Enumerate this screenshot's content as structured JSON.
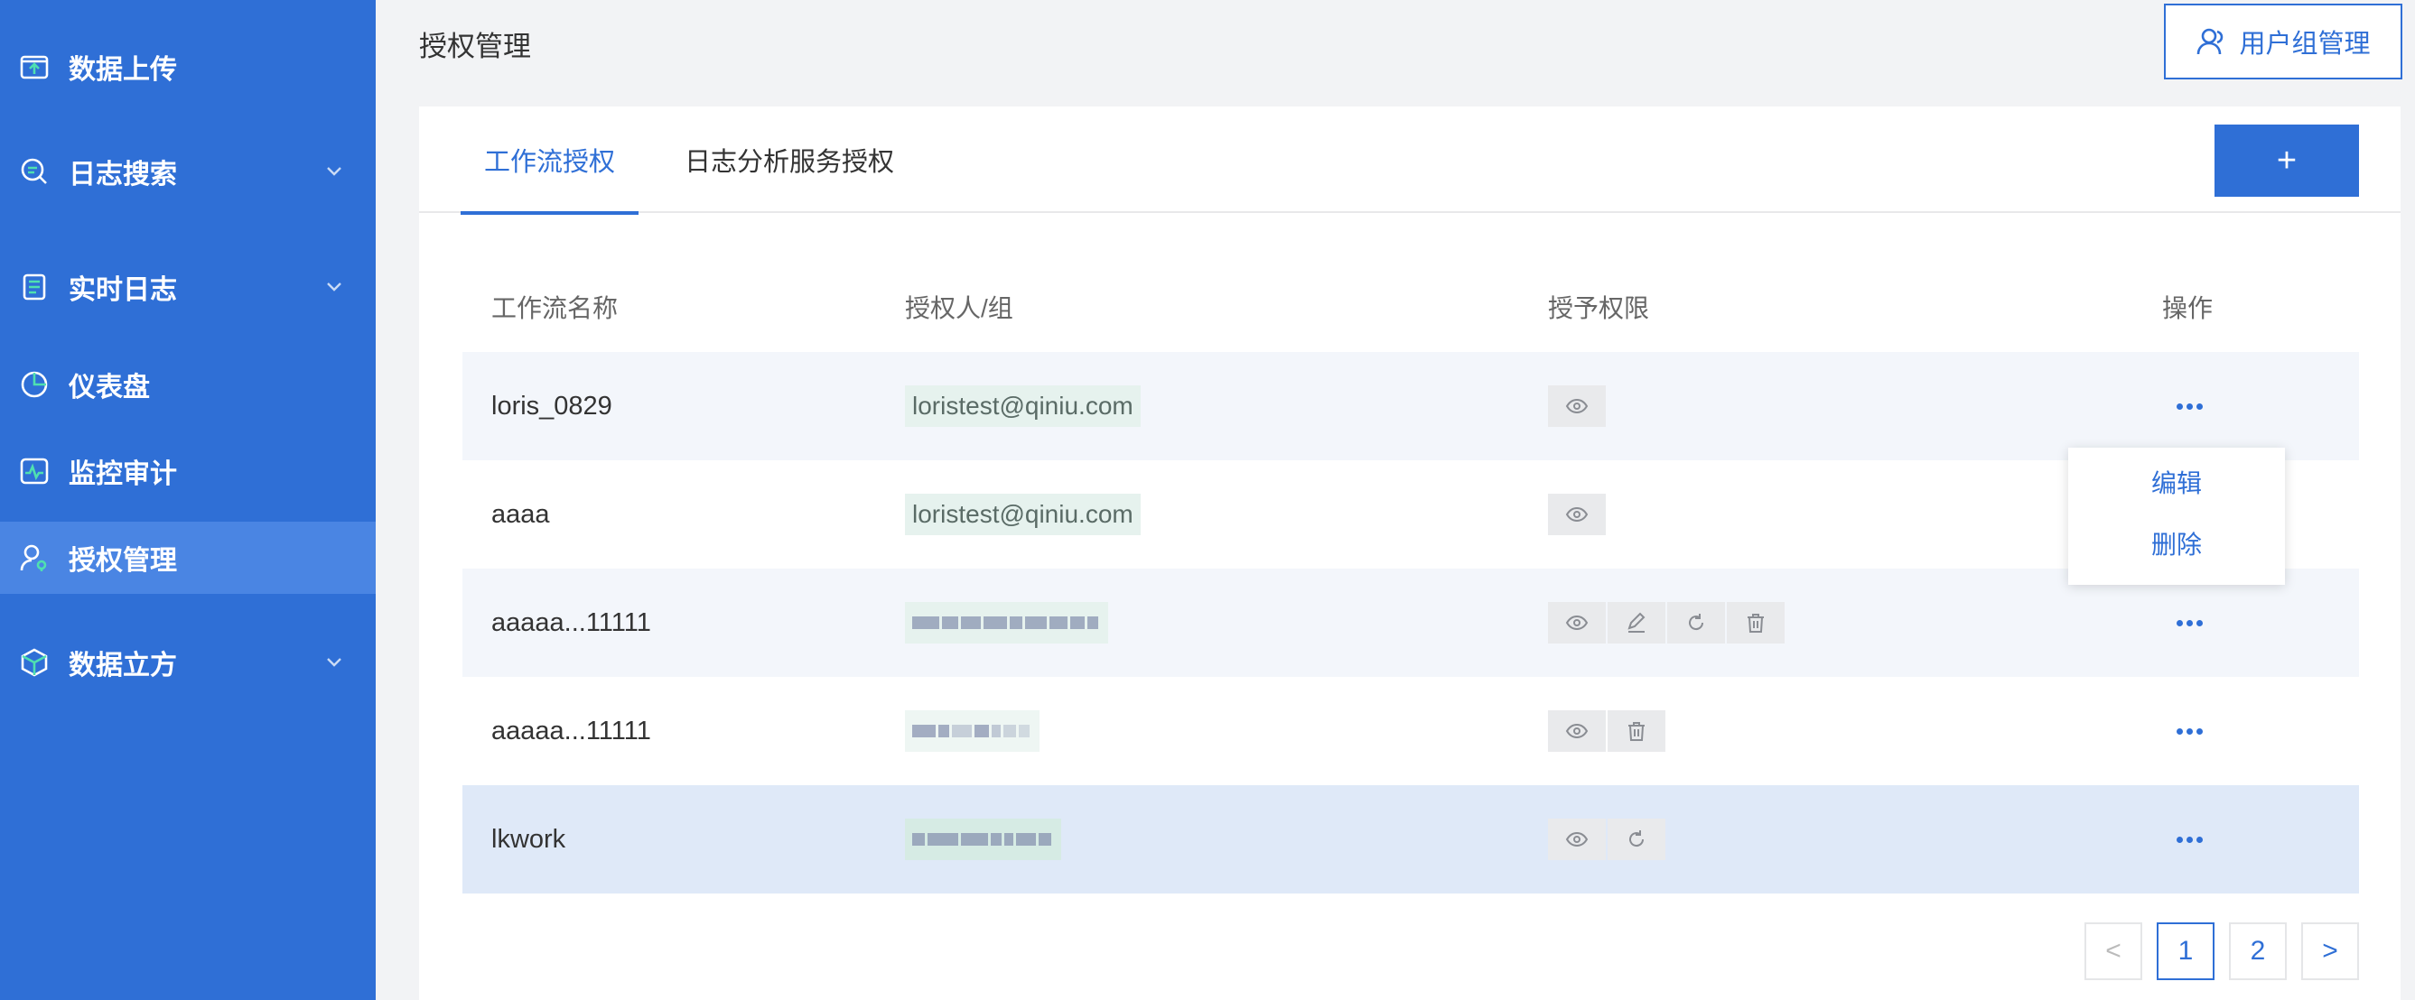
{
  "sidebar": {
    "items": [
      {
        "label": "数据上传",
        "icon": "upload-folder-icon",
        "has_children": false,
        "active": false
      },
      {
        "label": "日志搜索",
        "icon": "search-log-icon",
        "has_children": true,
        "active": false
      },
      {
        "label": "实时日志",
        "icon": "realtime-log-icon",
        "has_children": true,
        "active": false
      },
      {
        "label": "仪表盘",
        "icon": "dashboard-icon",
        "has_children": false,
        "active": false
      },
      {
        "label": "监控审计",
        "icon": "monitor-icon",
        "has_children": false,
        "active": false
      },
      {
        "label": "授权管理",
        "icon": "user-key-icon",
        "has_children": false,
        "active": true
      },
      {
        "label": "数据立方",
        "icon": "cube-icon",
        "has_children": true,
        "active": false
      }
    ]
  },
  "header": {
    "title": "授权管理",
    "group_button_label": "用户组管理"
  },
  "tabs": [
    {
      "label": "工作流授权",
      "active": true
    },
    {
      "label": "日志分析服务授权",
      "active": false
    }
  ],
  "add_button_label": "+",
  "table": {
    "columns": [
      "工作流名称",
      "授权人/组",
      "授予权限",
      "操作"
    ],
    "rows": [
      {
        "name": "loris_0829",
        "user": "loristest@qiniu.com",
        "user_redacted": false,
        "perms": [
          "view-icon"
        ]
      },
      {
        "name": "aaaa",
        "user": "loristest@qiniu.com",
        "user_redacted": false,
        "perms": [
          "view-icon"
        ]
      },
      {
        "name": "aaaaa...11111",
        "user": "",
        "user_redacted": true,
        "perms": [
          "view-icon",
          "edit-icon",
          "refresh-icon",
          "delete-icon"
        ]
      },
      {
        "name": "aaaaa...11111",
        "user": "",
        "user_redacted": true,
        "perms": [
          "view-icon",
          "delete-icon"
        ]
      },
      {
        "name": "lkwork",
        "user": "",
        "user_redacted": true,
        "perms": [
          "view-icon",
          "refresh-icon"
        ]
      }
    ]
  },
  "dropdown": {
    "items": [
      "编辑",
      "删除"
    ]
  },
  "pagination": {
    "prev": "<",
    "pages": [
      "1",
      "2"
    ],
    "current": "1",
    "next": ">"
  },
  "colors": {
    "brand": "#2f6fd6",
    "sidebar_active": "#4a85e3",
    "row_hover": "#dfe9f8"
  }
}
